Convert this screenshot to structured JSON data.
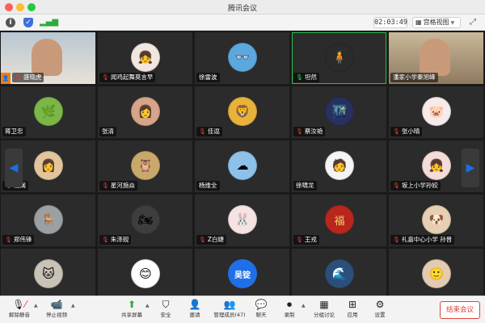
{
  "window": {
    "title": "腾讯会议"
  },
  "infobar": {
    "timer": "02:03:49",
    "view_label": "宫格视图"
  },
  "participants": [
    {
      "name": "盛晓虎",
      "mic": "muted",
      "host": true,
      "kind": "video",
      "bg": "#b9c7d3",
      "color": "#e8e1d6"
    },
    {
      "name": "闻鸡起舞莫言早",
      "mic": "muted",
      "kind": "avatar",
      "glyph": "👧",
      "color": "#f2e6e0"
    },
    {
      "name": "徐雷波",
      "mic": "none",
      "kind": "avatar",
      "glyph": "👓",
      "color": "#5aa8de"
    },
    {
      "name": "坦然",
      "mic": "on",
      "kind": "photo",
      "glyph": "🧍",
      "color": "#2b2b2b",
      "active": true
    },
    {
      "name": "潘家小学秦旭峰",
      "mic": "none",
      "kind": "video",
      "bg": "#c9b89a",
      "color": "#8f7a5f"
    },
    {
      "name": "蒋卫忠",
      "mic": "none",
      "kind": "avatar",
      "glyph": "🌿",
      "color": "#7ab648"
    },
    {
      "name": "张清",
      "mic": "none",
      "kind": "avatar",
      "glyph": "👩",
      "color": "#d6a589"
    },
    {
      "name": "佳逗",
      "mic": "muted",
      "kind": "avatar",
      "glyph": "🦁",
      "color": "#e9b23a"
    },
    {
      "name": "蔡汝艳",
      "mic": "muted",
      "kind": "avatar",
      "glyph": "🌃",
      "color": "#27305e"
    },
    {
      "name": "张小晴",
      "mic": "muted",
      "kind": "avatar",
      "glyph": "🐷",
      "color": "#f6eaea"
    },
    {
      "name": "钱闽",
      "mic": "muted",
      "kind": "avatar",
      "glyph": "👩",
      "color": "#e3c59c"
    },
    {
      "name": "星河施焱",
      "mic": "muted",
      "kind": "avatar",
      "glyph": "🦉",
      "color": "#c9a96b"
    },
    {
      "name": "杨维全",
      "mic": "none",
      "kind": "avatar",
      "glyph": "☁",
      "color": "#8ec1ea"
    },
    {
      "name": "徐啸龙",
      "mic": "none",
      "kind": "avatar",
      "glyph": "🧑",
      "color": "#f4f4f4"
    },
    {
      "name": "坂上小学孙姣",
      "mic": "muted",
      "kind": "avatar",
      "glyph": "👧",
      "color": "#f5dbd9"
    },
    {
      "name": "郑伟锋",
      "mic": "muted",
      "kind": "avatar",
      "glyph": "🪑",
      "color": "#9aa0a3"
    },
    {
      "name": "朱泽砚",
      "mic": "muted",
      "kind": "avatar",
      "glyph": "🏍",
      "color": "#3e3e3e"
    },
    {
      "name": "Z白婕",
      "mic": "muted",
      "kind": "avatar",
      "glyph": "🐰",
      "color": "#f6e2e2"
    },
    {
      "name": "王戎",
      "mic": "muted",
      "kind": "avatar",
      "glyph": "福",
      "color": "#b8261e"
    },
    {
      "name": "礼嘉中心小学 孙晋",
      "mic": "muted",
      "kind": "avatar",
      "glyph": "🐶",
      "color": "#e6cfb2"
    },
    {
      "name": "",
      "mic": "none",
      "kind": "avatar",
      "glyph": "🐱",
      "color": "#c9c2b6"
    },
    {
      "name": "",
      "mic": "none",
      "kind": "avatar",
      "glyph": "😊",
      "color": "#ffffff"
    },
    {
      "name": "",
      "mic": "none",
      "kind": "text",
      "glyph": "吴锭",
      "color": "#1f6fe8"
    },
    {
      "name": "",
      "mic": "none",
      "kind": "avatar",
      "glyph": "🌊",
      "color": "#2c4f7a"
    },
    {
      "name": "",
      "mic": "none",
      "kind": "avatar",
      "glyph": "🙂",
      "color": "#e2cbb1"
    }
  ],
  "toolbar": {
    "mute_label": "解除静音",
    "video_label": "停止视频",
    "share_label": "共享屏幕",
    "security_label": "安全",
    "invite_label": "邀请",
    "members_label": "管理成员(47)",
    "chat_label": "聊天",
    "record_label": "录制",
    "breakout_label": "分组讨论",
    "apps_label": "应用",
    "settings_label": "设置",
    "end_label": "结束会议"
  }
}
